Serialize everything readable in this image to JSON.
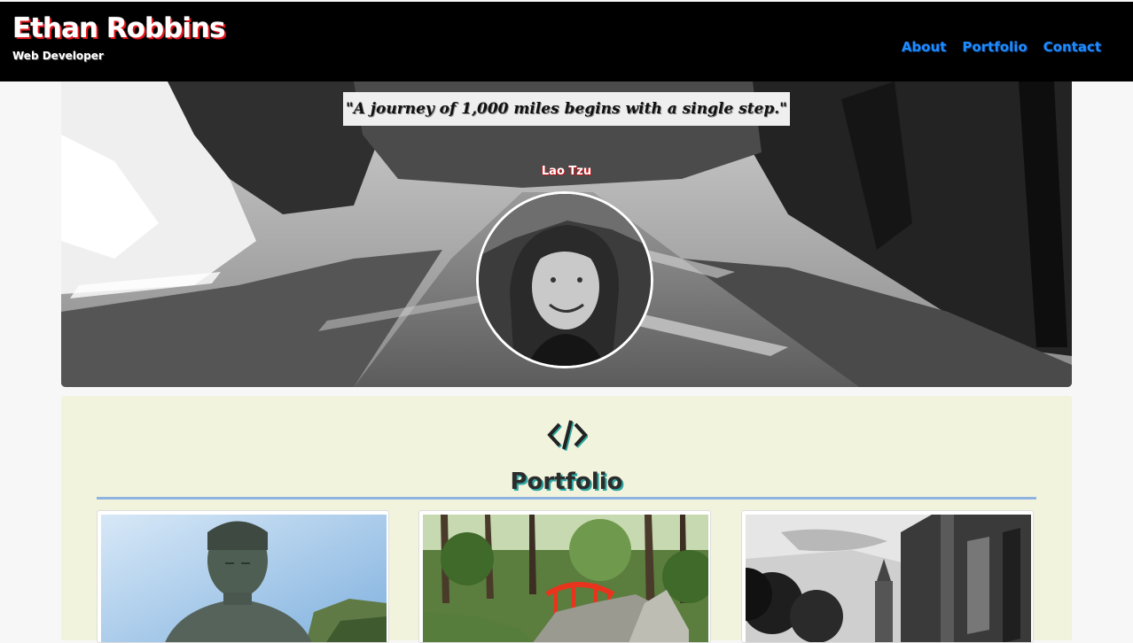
{
  "header": {
    "brand_name": "Ethan Robbins",
    "brand_subtitle": "Web Developer",
    "nav": [
      {
        "label": "About"
      },
      {
        "label": "Portfolio"
      },
      {
        "label": "Contact"
      }
    ],
    "nav_color": "#1e8cff",
    "brand_shadow_color": "#e0151b"
  },
  "hero": {
    "quote": "\"A journey of 1,000 miles begins with a single step.\"",
    "quote_author": "Lao Tzu",
    "avatar_icon": "profile-photo"
  },
  "portfolio": {
    "icon": "code-icon",
    "title": "Portfolio",
    "accent_color": "#8fb3e0",
    "background_color": "#f1f3dd",
    "cards": [
      {
        "image": "buddha-statue-photo"
      },
      {
        "image": "red-bridge-garden-photo"
      },
      {
        "image": "church-spire-street-photo"
      }
    ]
  }
}
